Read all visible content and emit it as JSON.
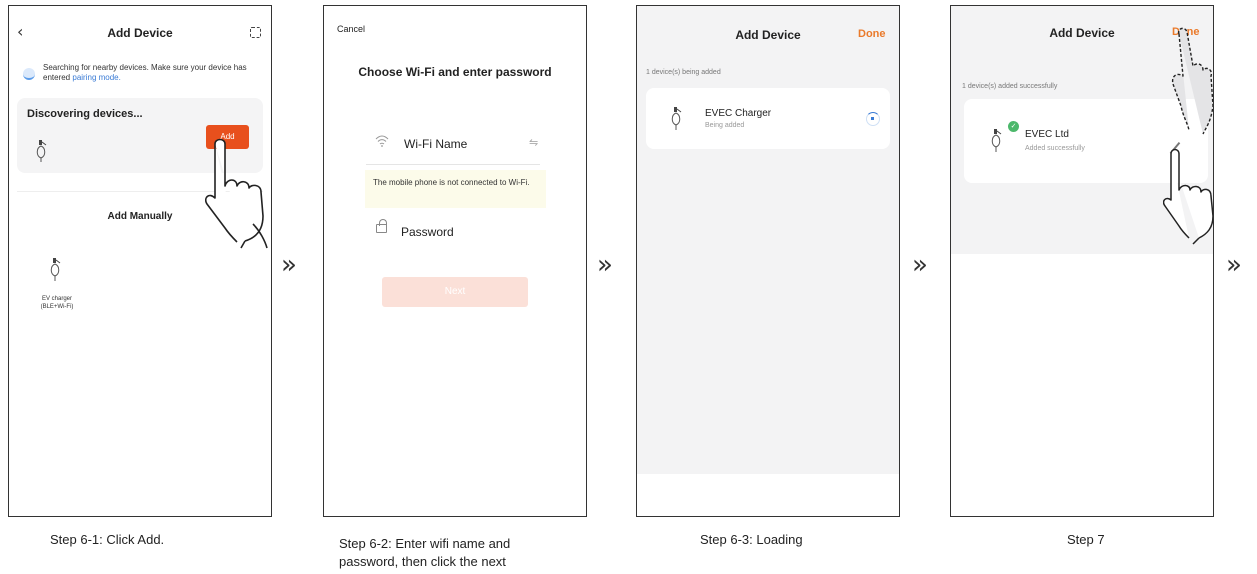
{
  "steps": [
    {
      "caption": "Step 6-1: Click Add.",
      "title": "Add Device",
      "search_text": "Searching for nearby devices. Make sure your device has entered",
      "search_link": "pairing mode.",
      "discover_title": "Discovering devices...",
      "add_button": "Add",
      "add_manually": "Add Manually",
      "device_label_line1": "EV charger",
      "device_label_line2": "(BLE+Wi-Fi)"
    },
    {
      "caption_line1": "Step 6-2: Enter wifi name and",
      "caption_line2": "password, then click the next",
      "cancel": "Cancel",
      "title": "Choose Wi-Fi and enter password",
      "wifi_name": "Wi-Fi Name",
      "warning": "The mobile phone is not connected to Wi-Fi.",
      "password": "Password",
      "next_button": "Next"
    },
    {
      "caption": "Step 6-3: Loading",
      "title": "Add Device",
      "done": "Done",
      "status_text": "1 device(s) being added",
      "device_name": "EVEC Charger",
      "device_status": "Being added"
    },
    {
      "caption": "Step 7",
      "title": "Add Device",
      "done": "Done",
      "status_text": "1 device(s) added successfully",
      "device_name": "EVEC Ltd",
      "device_status": "Added successfully"
    }
  ],
  "arrows": [
    "»",
    "»",
    "»",
    "»"
  ],
  "colors": {
    "accent_orange": "#e8501d",
    "done_orange": "#ea7a2b",
    "link_blue": "#3a7bd5",
    "success_green": "#4cb86b"
  },
  "icons": [
    "back-arrow-icon",
    "scan-icon",
    "wifi-icon",
    "swap-icon",
    "lock-icon",
    "ev-charger-icon",
    "check-icon",
    "edit-icon",
    "hand-pointer-icon"
  ]
}
